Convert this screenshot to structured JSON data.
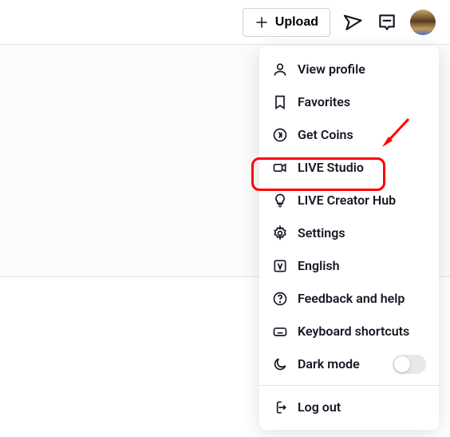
{
  "topbar": {
    "upload_label": "Upload"
  },
  "menu": {
    "items": [
      {
        "label": "View profile"
      },
      {
        "label": "Favorites"
      },
      {
        "label": "Get Coins"
      },
      {
        "label": "LIVE Studio"
      },
      {
        "label": "LIVE Creator Hub"
      },
      {
        "label": "Settings"
      },
      {
        "label": "English"
      },
      {
        "label": "Feedback and help"
      },
      {
        "label": "Keyboard shortcuts"
      },
      {
        "label": "Dark mode"
      }
    ],
    "logout_label": "Log out"
  }
}
